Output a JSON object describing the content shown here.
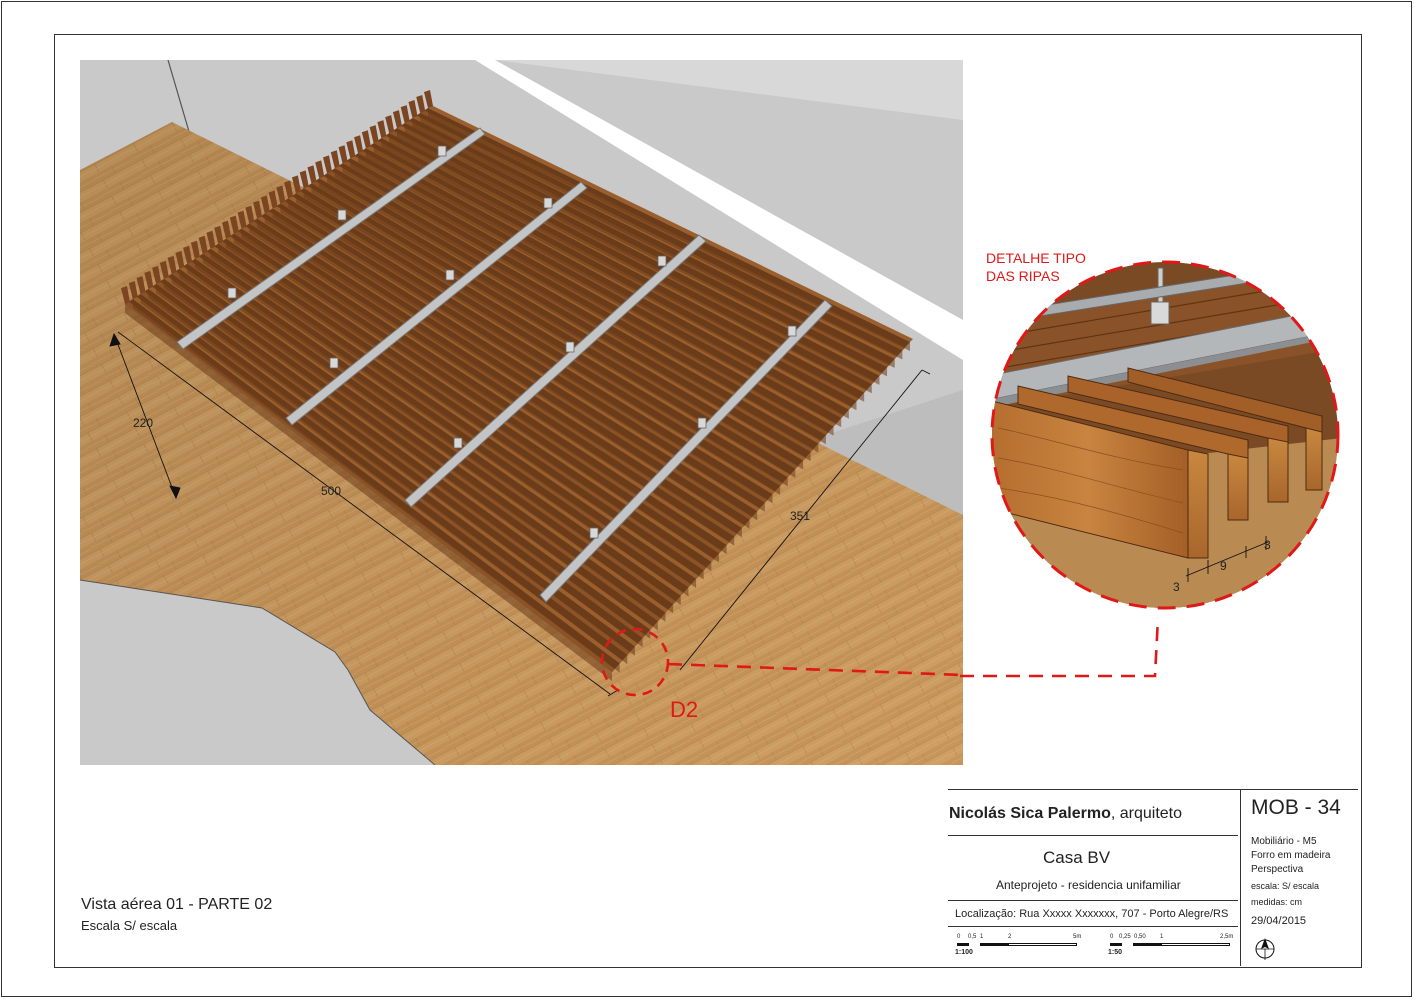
{
  "drawing": {
    "dimensions": {
      "width": "220",
      "length": "500",
      "depth": "351"
    },
    "detail_marker": "D2",
    "detail": {
      "title_line1": "DETALHE TIPO",
      "title_line2": "DAS RIPAS",
      "dim_gap_left": "3",
      "dim_slat": "9",
      "dim_gap_right": "3"
    }
  },
  "view": {
    "title": "Vista aérea 01 - PARTE 02",
    "scale": "Escala S/ escala"
  },
  "title_block": {
    "architect_name": "Nicolás Sica Palermo",
    "architect_role": ", arquiteto",
    "project": "Casa BV",
    "phase": "Anteprojeto - residencia unifamiliar",
    "location": "Localização: Rua Xxxxx Xxxxxxx, 707 - Porto Alegre/RS",
    "sheet_code": "MOB - 34",
    "sheet_line1": "Mobiliário - M5",
    "sheet_line2": "Forro em madeira",
    "sheet_line3": "Perspectiva",
    "scale_note": "escala: S/ escala",
    "units_note": "medidas: cm",
    "date": "29/04/2015",
    "scalebar_100": {
      "ticks": [
        "0",
        "0,5",
        "1",
        "2",
        "5m"
      ],
      "label": "1:100"
    },
    "scalebar_50": {
      "ticks": [
        "0",
        "0,25",
        "0,50",
        "1",
        "2,5m"
      ],
      "label": "1:50"
    }
  },
  "colors": {
    "detail_red": "#e01818",
    "wood_slat": "#8a5228",
    "wood_floor": "#c99a5e",
    "metal_rail": "#b9bcbf",
    "wall_grey": "#c8c8c8"
  }
}
